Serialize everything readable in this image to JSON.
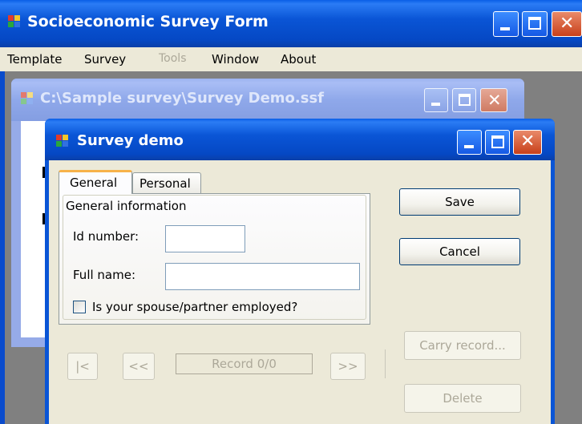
{
  "main_window": {
    "title": "Socioeconomic Survey Form",
    "menu": [
      {
        "label": "Template",
        "enabled": true
      },
      {
        "label": "Survey",
        "enabled": true
      },
      {
        "label": "Tools",
        "enabled": false
      },
      {
        "label": "Window",
        "enabled": true
      },
      {
        "label": "About",
        "enabled": true
      }
    ]
  },
  "document_window": {
    "title": "C:\\Sample survey\\Survey Demo.ssf"
  },
  "dialog": {
    "title": "Survey demo",
    "tabs": [
      {
        "label": "General",
        "active": true
      },
      {
        "label": "Personal",
        "active": false
      }
    ],
    "group_title": "General information",
    "fields": {
      "id_label": "Id number:",
      "id_value": "",
      "name_label": "Full name:",
      "name_value": ""
    },
    "checkbox": {
      "label": "Is your spouse/partner employed?",
      "checked": false
    },
    "buttons": {
      "save": "Save",
      "cancel": "Cancel",
      "carry": "Carry record...",
      "delete": "Delete"
    },
    "nav": {
      "first": "|<",
      "prev": "<<",
      "record": "Record 0/0",
      "next": ">>"
    }
  },
  "colors": {
    "titlebar_active": "#0a55d6",
    "titlebar_inactive": "#8fa8ea",
    "close_button": "#c8401a",
    "control_face": "#ece9d8",
    "button_border": "#003c74",
    "disabled_text": "#aca899",
    "workspace": "#808080"
  },
  "icons": [
    "app-icon",
    "minimize-icon",
    "maximize-icon",
    "close-icon"
  ]
}
